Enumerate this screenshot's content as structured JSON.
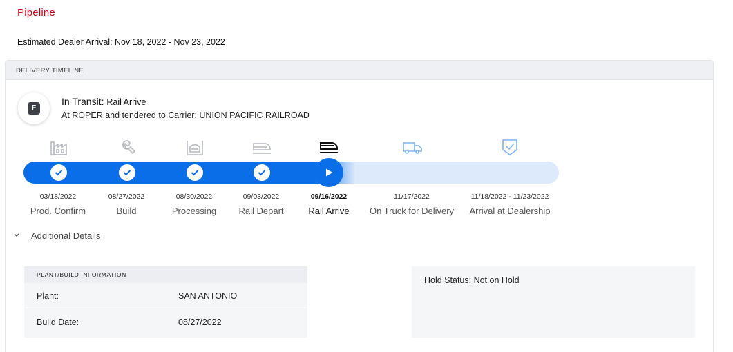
{
  "page": {
    "title": "Pipeline",
    "eta": "Estimated Dealer Arrival: Nov 18, 2022 - Nov 23, 2022"
  },
  "timeline": {
    "header": "DELIVERY TIMELINE",
    "badge": "F",
    "status_main": "In Transit:",
    "status_sub": "Rail Arrive",
    "location": "At ROPER and tendered to Carrier: UNION PACIFIC RAILROAD",
    "progress_completed_steps": 5,
    "progress_total_steps": 7,
    "accent_color": "#0a6ee8",
    "steps": [
      {
        "date": "03/18/2022",
        "label": "Prod. Confirm",
        "state": "done",
        "icon": "factory-icon"
      },
      {
        "date": "08/27/2022",
        "label": "Build",
        "state": "done",
        "icon": "wrench-icon"
      },
      {
        "date": "08/30/2022",
        "label": "Processing",
        "state": "done",
        "icon": "processing-icon"
      },
      {
        "date": "09/03/2022",
        "label": "Rail Depart",
        "state": "done",
        "icon": "rail-depart-icon"
      },
      {
        "date": "09/16/2022",
        "label": "Rail Arrive",
        "state": "current",
        "icon": "rail-arrive-icon"
      },
      {
        "date": "11/17/2022",
        "label": "On Truck for Delivery",
        "state": "upcoming",
        "icon": "truck-icon"
      },
      {
        "date": "11/18/2022 - 11/23/2022",
        "label": "Arrival at Dealership",
        "state": "upcoming",
        "icon": "shield-check-icon"
      }
    ]
  },
  "details": {
    "toggle_label": "Additional Details",
    "plant_header": "PLANT/BUILD INFORMATION",
    "rows": [
      {
        "key": "Plant:",
        "value": "SAN ANTONIO"
      },
      {
        "key": "Build Date:",
        "value": "08/27/2022"
      }
    ],
    "hold_status": "Hold Status: Not on Hold"
  }
}
